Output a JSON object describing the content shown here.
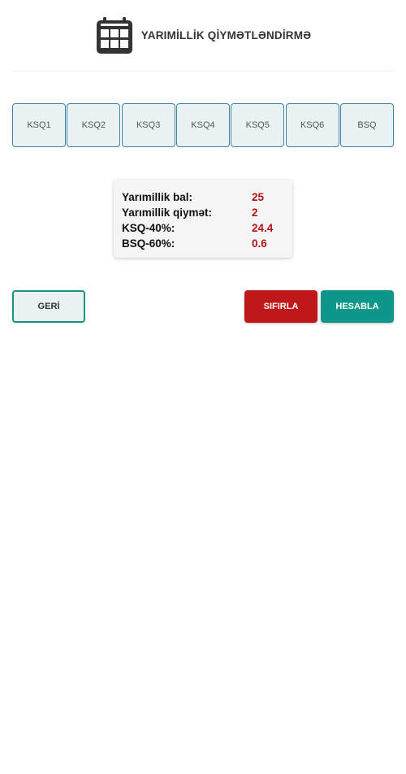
{
  "header": {
    "title": "YARIMİLLİK QİYMƏTLƏNDİRMƏ",
    "icon": "calendar-icon"
  },
  "tabs": [
    {
      "label": "KSQ1"
    },
    {
      "label": "KSQ2"
    },
    {
      "label": "KSQ3"
    },
    {
      "label": "KSQ4"
    },
    {
      "label": "KSQ5"
    },
    {
      "label": "KSQ6"
    },
    {
      "label": "BSQ"
    }
  ],
  "result": {
    "rows": [
      {
        "label": "Yarımillik bal:",
        "value": "25"
      },
      {
        "label": "Yarımillik qiymət:",
        "value": "2"
      },
      {
        "label": "KSQ-40%:",
        "value": "24.4"
      },
      {
        "label": "BSQ-60%:",
        "value": "0.6"
      }
    ]
  },
  "buttons": {
    "back": "GERİ",
    "reset": "SIFIRLA",
    "calculate": "HESABLA"
  },
  "colors": {
    "accent_teal": "#0e968a",
    "reset_red": "#c0171b",
    "value_red": "#b01414",
    "tab_border": "#3f7fa8",
    "tab_bg": "#e8f3f1"
  }
}
